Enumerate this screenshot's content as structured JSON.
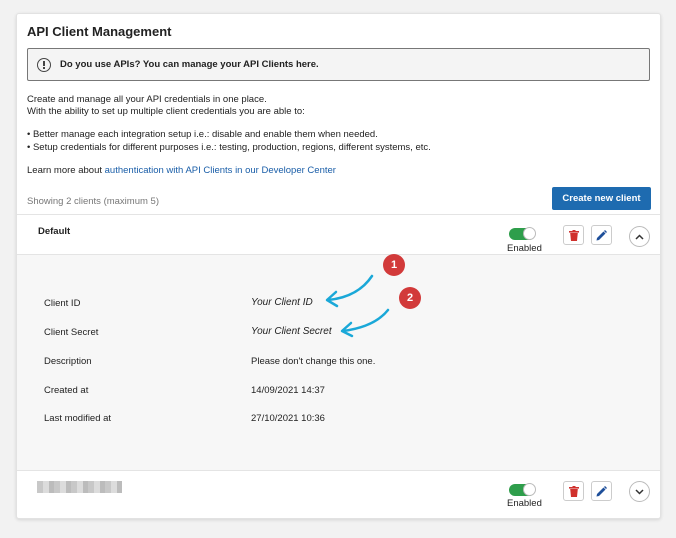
{
  "title": "API Client Management",
  "notice": "Do you use APIs? You can manage your API Clients here.",
  "description": [
    "Create and manage all your API credentials in one place.",
    "With the ability to set up multiple client credentials you are able to:"
  ],
  "bullets": [
    "Better manage each integration setup i.e.: disable and enable them when needed.",
    "Setup credentials for different purposes i.e.: testing, production, regions, different systems, etc."
  ],
  "learn": {
    "prefix": "Learn more about ",
    "link": "authentication with API Clients in our Developer Center"
  },
  "showing": "Showing 2 clients (maximum 5)",
  "create_button": "Create new client",
  "clients": [
    {
      "name": "Default",
      "status": "Enabled",
      "expanded": true
    },
    {
      "name": "",
      "status": "Enabled",
      "expanded": false
    }
  ],
  "details": {
    "client_id": {
      "label": "Client ID",
      "value": "Your Client ID"
    },
    "client_secret": {
      "label": "Client Secret",
      "value": "Your Client Secret"
    },
    "description": {
      "label": "Description",
      "value": "Please don't change this one."
    },
    "created": {
      "label": "Created at",
      "value": "14/09/2021 14:37"
    },
    "modified": {
      "label": "Last modified at",
      "value": "27/10/2021 10:36"
    }
  },
  "annotations": [
    "1",
    "2"
  ],
  "colors": {
    "accent": "#1e6bb0",
    "toggle_on": "#2e9e4b",
    "badge": "#d23a3a",
    "arrow": "#1aa8d8",
    "delete": "#d0312d"
  },
  "icons": {
    "notice": "info-circle-icon",
    "delete": "trash-icon",
    "edit": "pencil-icon",
    "collapse": "chevron-up-icon",
    "expand": "chevron-down-icon"
  }
}
